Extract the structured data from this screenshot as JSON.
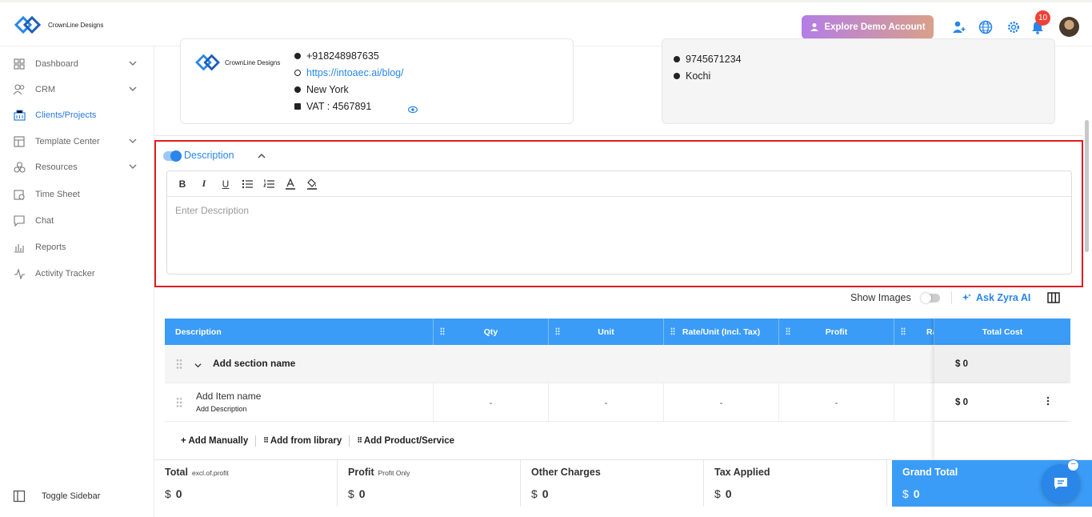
{
  "brand": {
    "name": "CrownLine Designs"
  },
  "topbar": {
    "demo_button": "Explore Demo Account",
    "notification_count": "10"
  },
  "sidebar": {
    "items": [
      {
        "label": "Dashboard",
        "icon": "grid-icon",
        "has_chevron": true
      },
      {
        "label": "CRM",
        "icon": "users-icon",
        "has_chevron": true
      },
      {
        "label": "Clients/Projects",
        "icon": "building-icon",
        "active": true
      },
      {
        "label": "Template Center",
        "icon": "template-icon",
        "has_chevron": true
      },
      {
        "label": "Resources",
        "icon": "resources-icon",
        "has_chevron": true
      },
      {
        "label": "Time Sheet",
        "icon": "clock-icon"
      },
      {
        "label": "Chat",
        "icon": "chat-icon"
      },
      {
        "label": "Reports",
        "icon": "bar-chart-icon"
      },
      {
        "label": "Activity Tracker",
        "icon": "activity-icon"
      }
    ],
    "toggle_label": "Toggle Sidebar"
  },
  "company_card": {
    "phone": "+918248987635",
    "website": "https://intoaec.ai/blog/",
    "city": "New York",
    "vat": "VAT : 4567891"
  },
  "client_card": {
    "phone": "9745671234",
    "city": "Kochi"
  },
  "description": {
    "label": "Description",
    "placeholder": "Enter Description"
  },
  "table_controls": {
    "show_images": "Show Images",
    "ask_ai": "Ask Zyra AI"
  },
  "table": {
    "headers": [
      "Description",
      "Qty",
      "Unit",
      "Rate/Unit (Incl. Tax)",
      "Profit",
      "Ra",
      "Total Cost"
    ],
    "section": {
      "name": "Add section name",
      "total": "$ 0"
    },
    "item": {
      "name": "Add Item name",
      "description": "Add Description",
      "qty": "-",
      "unit": "-",
      "rate": "-",
      "profit": "-",
      "total": "$ 0"
    },
    "actions": [
      "+ Add Manually",
      "Add from library",
      "Add Product/Service"
    ]
  },
  "totals": [
    {
      "label": "Total",
      "sub": "excl.of.profit",
      "currency": "$",
      "value": "0"
    },
    {
      "label": "Profit",
      "sub": "Profit Only",
      "currency": "$",
      "value": "0"
    },
    {
      "label": "Other Charges",
      "sub": "",
      "currency": "$",
      "value": "0"
    },
    {
      "label": "Tax Applied",
      "sub": "",
      "currency": "$",
      "value": "0"
    },
    {
      "label": "Grand Total",
      "sub": "",
      "currency": "$",
      "value": "0"
    }
  ],
  "colors": {
    "accent": "#3a9cf6",
    "highlight": "#e31b1b",
    "grand_total_bg": "#3a9cf6"
  }
}
